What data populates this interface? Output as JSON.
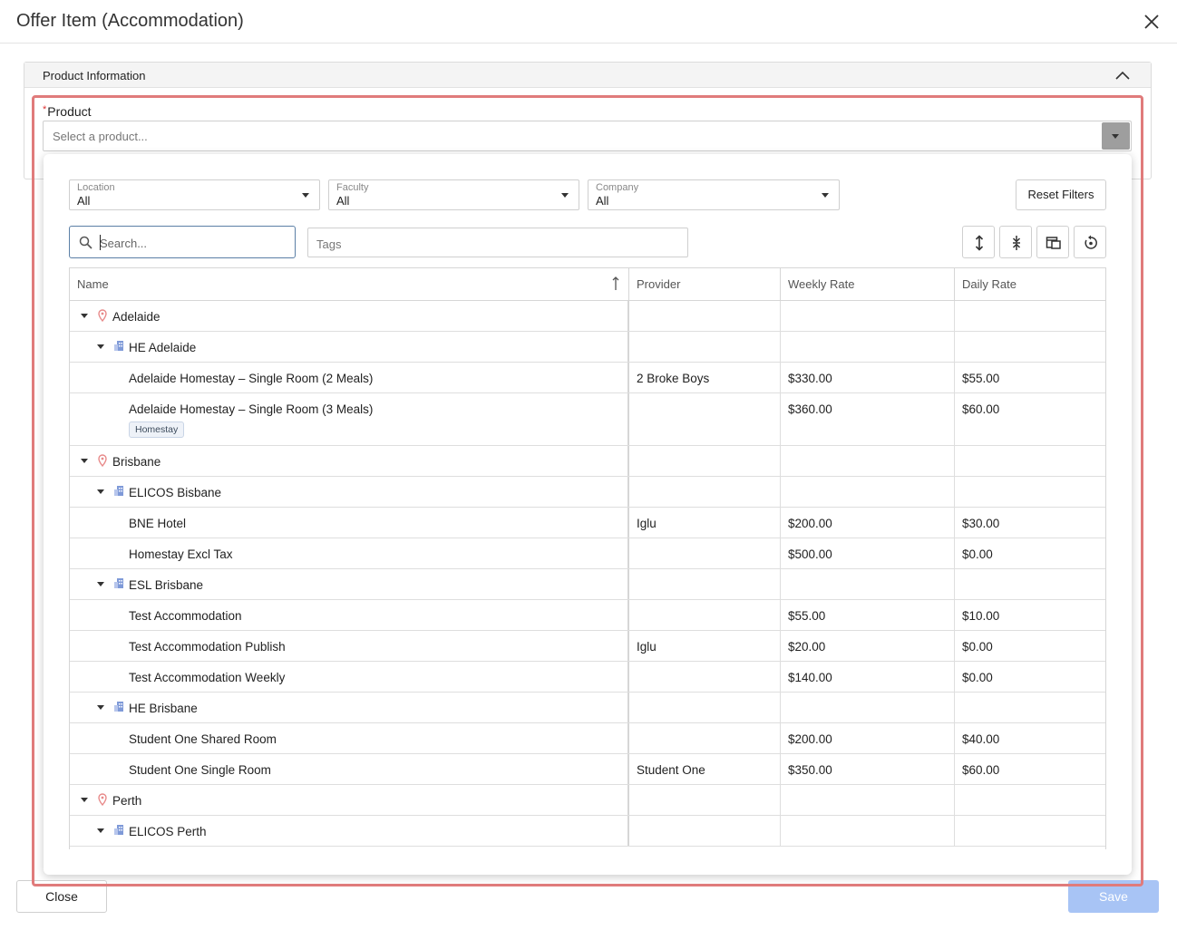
{
  "modal": {
    "title": "Offer Item (Accommodation)",
    "close_icon": "close-icon"
  },
  "section": {
    "title": "Product Information",
    "collapse_icon": "chevron-up-icon"
  },
  "product": {
    "required_mark": "*",
    "label": "Product",
    "placeholder": "Select a product..."
  },
  "filters": {
    "location": {
      "label": "Location",
      "value": "All"
    },
    "faculty": {
      "label": "Faculty",
      "value": "All"
    },
    "company": {
      "label": "Company",
      "value": "All"
    },
    "reset_label": "Reset Filters"
  },
  "search": {
    "placeholder": "Search...",
    "value": ""
  },
  "tags": {
    "placeholder": "Tags"
  },
  "toolbar": {
    "icons": [
      "expand-all-icon",
      "collapse-all-icon",
      "column-chooser-icon",
      "reset-view-icon"
    ]
  },
  "grid": {
    "columns": [
      "Name",
      "Provider",
      "Weekly Rate",
      "Daily Rate"
    ],
    "sort_column": "Name",
    "sort_icon": "sort-ascending-icon",
    "rows": [
      {
        "level": 0,
        "type": "location",
        "name": "Adelaide",
        "provider": "",
        "weekly": "",
        "daily": ""
      },
      {
        "level": 1,
        "type": "faculty",
        "name": "HE Adelaide",
        "provider": "",
        "weekly": "",
        "daily": ""
      },
      {
        "level": 2,
        "type": "item",
        "name": "Adelaide Homestay – Single Room (2 Meals)",
        "provider": "2 Broke Boys",
        "weekly": "$330.00",
        "daily": "$55.00"
      },
      {
        "level": 2,
        "type": "item",
        "name": "Adelaide Homestay – Single Room (3 Meals)",
        "provider": "",
        "weekly": "$360.00",
        "daily": "$60.00",
        "tag": "Homestay"
      },
      {
        "level": 0,
        "type": "location",
        "name": "Brisbane",
        "provider": "",
        "weekly": "",
        "daily": ""
      },
      {
        "level": 1,
        "type": "faculty",
        "name": "ELICOS Bisbane",
        "provider": "",
        "weekly": "",
        "daily": ""
      },
      {
        "level": 2,
        "type": "item",
        "name": "BNE Hotel",
        "provider": "Iglu",
        "weekly": "$200.00",
        "daily": "$30.00"
      },
      {
        "level": 2,
        "type": "item",
        "name": "Homestay Excl Tax",
        "provider": "",
        "weekly": "$500.00",
        "daily": "$0.00"
      },
      {
        "level": 1,
        "type": "faculty",
        "name": "ESL Brisbane",
        "provider": "",
        "weekly": "",
        "daily": ""
      },
      {
        "level": 2,
        "type": "item",
        "name": "Test Accommodation",
        "provider": "",
        "weekly": "$55.00",
        "daily": "$10.00"
      },
      {
        "level": 2,
        "type": "item",
        "name": "Test Accommodation Publish",
        "provider": "Iglu",
        "weekly": "$20.00",
        "daily": "$0.00"
      },
      {
        "level": 2,
        "type": "item",
        "name": "Test Accommodation Weekly",
        "provider": "",
        "weekly": "$140.00",
        "daily": "$0.00"
      },
      {
        "level": 1,
        "type": "faculty",
        "name": "HE Brisbane",
        "provider": "",
        "weekly": "",
        "daily": ""
      },
      {
        "level": 2,
        "type": "item",
        "name": "Student One Shared Room",
        "provider": "",
        "weekly": "$200.00",
        "daily": "$40.00"
      },
      {
        "level": 2,
        "type": "item",
        "name": "Student One Single Room",
        "provider": "Student One",
        "weekly": "$350.00",
        "daily": "$60.00"
      },
      {
        "level": 0,
        "type": "location",
        "name": "Perth",
        "provider": "",
        "weekly": "",
        "daily": ""
      },
      {
        "level": 1,
        "type": "faculty",
        "name": "ELICOS Perth",
        "provider": "",
        "weekly": "",
        "daily": ""
      }
    ]
  },
  "footer": {
    "close_label": "Close",
    "save_label": "Save"
  },
  "colors": {
    "highlight_border": "#e07b7b",
    "save_disabled": "#a8c4f5",
    "location_pin": "#e88a8a",
    "faculty_building": "#7f9ad8",
    "search_focus": "#5b7fa6"
  }
}
